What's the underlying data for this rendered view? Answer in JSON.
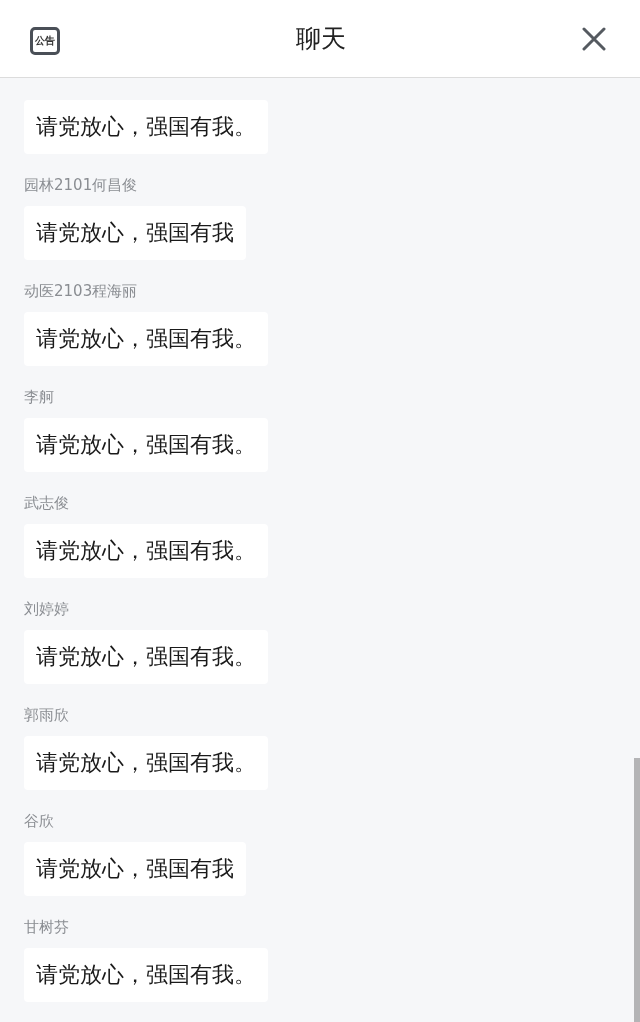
{
  "header": {
    "notice_label": "公告",
    "title": "聊天"
  },
  "messages": [
    {
      "text": "请党放心，强国有我。"
    },
    {
      "sender": "园林2101何昌俊",
      "text": "请党放心，强国有我"
    },
    {
      "sender": "动医2103程海丽",
      "text": "请党放心，强国有我。"
    },
    {
      "sender": "李舸",
      "text": "请党放心，强国有我。"
    },
    {
      "sender": "武志俊",
      "text": "请党放心，强国有我。"
    },
    {
      "sender": "刘婷婷",
      "text": "请党放心，强国有我。"
    },
    {
      "sender": "郭雨欣",
      "text": "请党放心，强国有我。"
    },
    {
      "sender": "谷欣",
      "text": "请党放心，强国有我"
    },
    {
      "sender": "甘树芬",
      "text": "请党放心，强国有我。"
    }
  ]
}
